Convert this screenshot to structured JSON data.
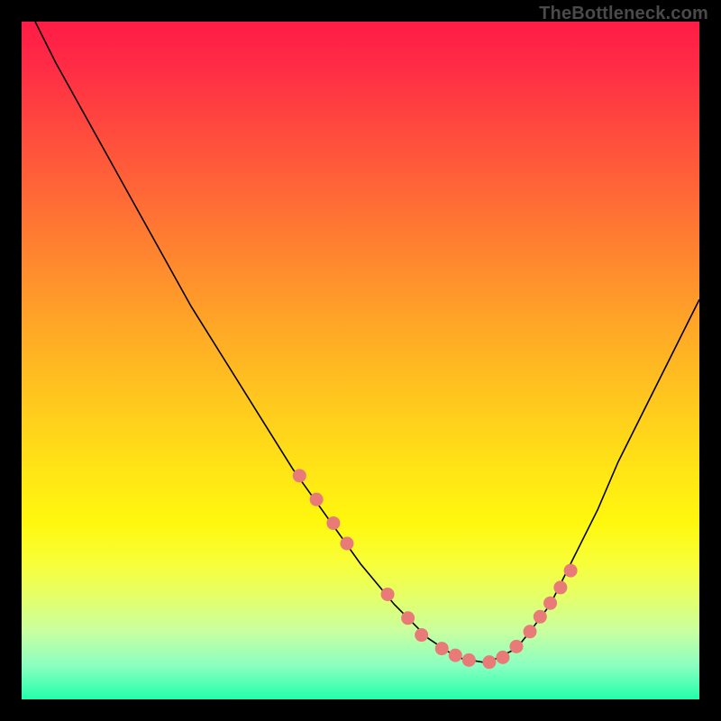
{
  "watermark": "TheBottleneck.com",
  "colors": {
    "page_bg": "#000000",
    "gradient_top": "#ff1c46",
    "gradient_bottom": "#22ffaa",
    "curve": "#000000",
    "dots": "#e87a78",
    "watermark": "#4a4a4a"
  },
  "chart_data": {
    "type": "line",
    "title": "",
    "xlabel": "",
    "ylabel": "",
    "xlim": [
      0,
      100
    ],
    "ylim": [
      0,
      100
    ],
    "grid": false,
    "legend": false,
    "series": [
      {
        "name": "curve",
        "x": [
          2,
          5,
          10,
          15,
          20,
          25,
          30,
          35,
          40,
          45,
          50,
          55,
          58,
          60,
          63,
          65,
          68,
          70,
          73,
          75,
          78,
          80,
          82,
          85,
          88,
          92,
          96,
          100
        ],
        "values": [
          100,
          94,
          85,
          76,
          67,
          58,
          50,
          42,
          34,
          27,
          20,
          14,
          11,
          9,
          7,
          6,
          5.5,
          6,
          7.5,
          10,
          14,
          18,
          22,
          28,
          35,
          43,
          51,
          59
        ]
      }
    ],
    "highlight_points": {
      "name": "dots",
      "x": [
        41,
        43.5,
        46,
        48,
        54,
        57,
        59,
        62,
        64,
        66,
        69,
        71,
        73,
        75,
        76.5,
        78,
        79.5,
        81
      ],
      "values": [
        33,
        29.5,
        26,
        23,
        15.5,
        12,
        9.5,
        7.5,
        6.5,
        5.8,
        5.5,
        6.2,
        7.8,
        10,
        12.2,
        14.2,
        16.5,
        19
      ]
    }
  }
}
